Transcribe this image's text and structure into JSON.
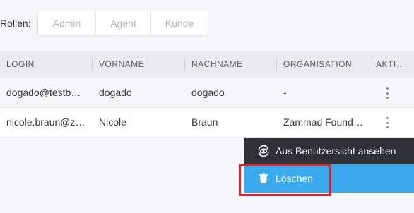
{
  "roles": {
    "label": "Rollen:",
    "options": [
      "Admin",
      "Agent",
      "Kunde"
    ]
  },
  "table": {
    "columns": [
      "LOGIN",
      "VORNAME",
      "NACHNAME",
      "ORGANISATION",
      "AKTI…"
    ],
    "rows": [
      {
        "login": "dogado@testb…",
        "vorname": "dogado",
        "nachname": "dogado",
        "organisation": "-"
      },
      {
        "login": "nicole.braun@z…",
        "vorname": "Nicole",
        "nachname": "Braun",
        "organisation": "Zammad Found…"
      }
    ]
  },
  "context_menu": {
    "items": [
      {
        "label": "Aus Benutzersicht ansehen",
        "icon": "view-as-user-icon"
      },
      {
        "label": "Löschen",
        "icon": "trash-icon"
      }
    ]
  },
  "colors": {
    "menu_dark": "#2e3137",
    "menu_highlight": "#3ba9ee",
    "annotation": "#e0202a"
  }
}
